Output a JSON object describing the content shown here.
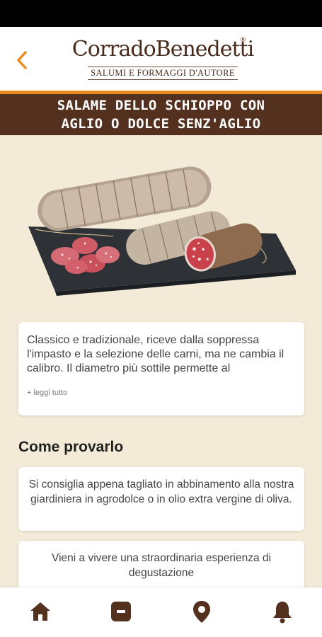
{
  "brand": {
    "name": "CorradoBenedetti",
    "registered_mark": "®",
    "tagline": "SALUMI E FORMAGGI D'AUTORE"
  },
  "product": {
    "title_line1": "SALAME DELLO SCHIOPPO CON",
    "title_line2": "AGLIO O DOLCE SENZ'AGLIO",
    "description": "Classico e tradizionale, riceve dalla soppressa l'impasto e la selezione delle carni, ma ne cambia il calibro. Il diametro più sottile permette al",
    "read_more": "+ leggi tutto"
  },
  "how_to": {
    "heading": "Come provarlo",
    "tip": "Si consiglia appena tagliato in abbinamento alla nostra giardiniera in agrodolce o in olio extra vergine di oliva."
  },
  "experience": {
    "text": "Vieni a vivere una straordinaria esperienza di degustazione"
  },
  "nav": {
    "items": [
      {
        "icon": "home-icon"
      },
      {
        "icon": "catalog-icon"
      },
      {
        "icon": "location-pin-icon"
      },
      {
        "icon": "bell-icon"
      }
    ]
  },
  "colors": {
    "accent": "#e98b1f",
    "band": "#54311f",
    "background": "#f4ead8",
    "icon": "#54311f"
  }
}
